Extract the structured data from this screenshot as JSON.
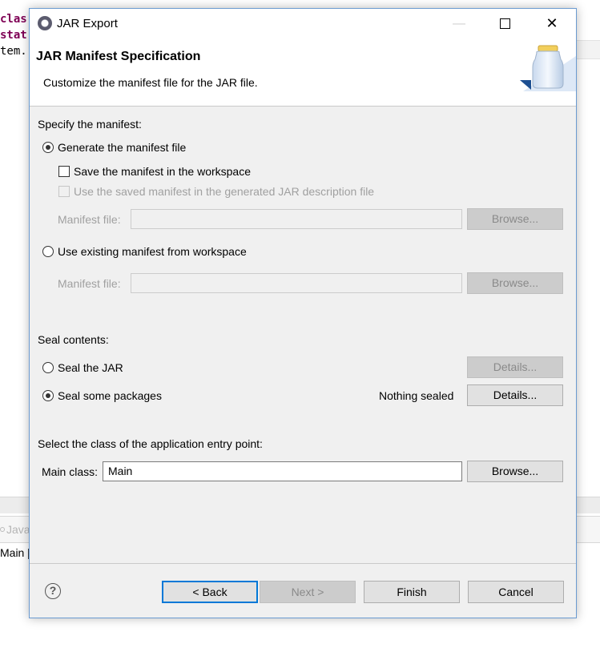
{
  "background": {
    "code_lines": [
      "clas",
      "stat",
      "tem."
    ],
    "tab_label": "Java",
    "row_text": "Main ["
  },
  "dialog": {
    "title": "JAR Export",
    "window_controls": {
      "minimize": "—",
      "close": "✕"
    },
    "banner": {
      "title": "JAR Manifest Specification",
      "description": "Customize the manifest file for the JAR file."
    },
    "manifest": {
      "section_label": "Specify the manifest:",
      "generate_label": "Generate the manifest file",
      "generate_selected": true,
      "save_label": "Save the manifest in the workspace",
      "save_checked": false,
      "use_saved_label": "Use the saved manifest in the generated JAR description file",
      "manifest_file_label": "Manifest file:",
      "manifest_file_value": "",
      "browse_label": "Browse...",
      "existing_label": "Use existing manifest from workspace",
      "existing_selected": false,
      "existing_manifest_file_label": "Manifest file:",
      "existing_manifest_file_value": "",
      "existing_browse_label": "Browse..."
    },
    "seal": {
      "section_label": "Seal contents:",
      "seal_jar_label": "Seal the JAR",
      "seal_jar_selected": false,
      "seal_jar_details_label": "Details...",
      "seal_some_label": "Seal some packages",
      "seal_some_selected": true,
      "status_text": "Nothing sealed",
      "seal_some_details_label": "Details..."
    },
    "entry_point": {
      "section_label": "Select the class of the application entry point:",
      "main_class_label": "Main class:",
      "main_class_value": "Main",
      "browse_label": "Browse..."
    },
    "footer": {
      "help_symbol": "?",
      "back_label": "< Back",
      "next_label": "Next >",
      "finish_label": "Finish",
      "cancel_label": "Cancel"
    }
  },
  "colors": {
    "dialog_bg": "#f0f0f0",
    "accent": "#0078d7",
    "keyword": "#7f0055",
    "disabled_text": "#a0a0a0"
  }
}
